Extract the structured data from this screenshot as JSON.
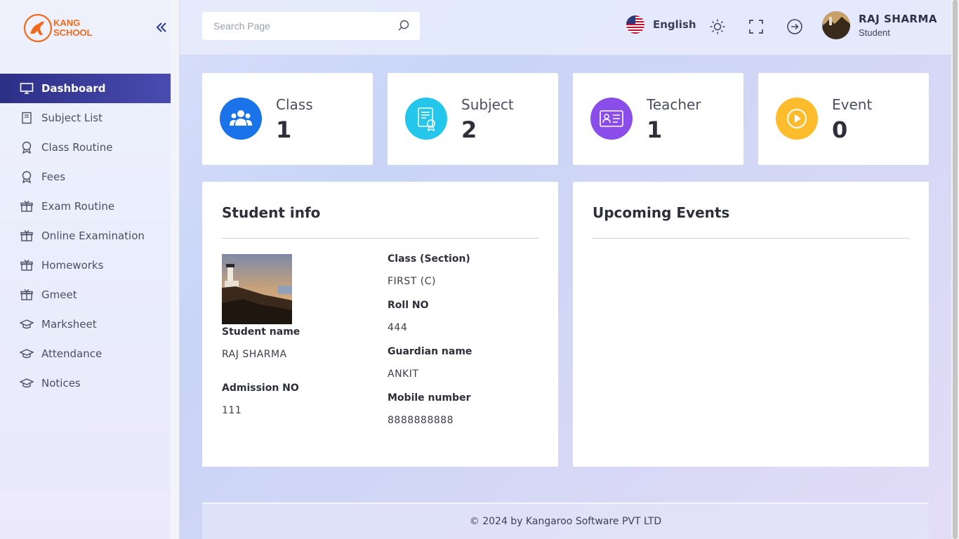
{
  "brand": {
    "line1": "KANG",
    "line2": "SCHOOL",
    "accent": "#f26b1d"
  },
  "sidebar": {
    "items": [
      {
        "label": "Dashboard",
        "icon": "monitor-icon",
        "active": true
      },
      {
        "label": "Subject List",
        "icon": "book-icon"
      },
      {
        "label": "Class Routine",
        "icon": "award-icon"
      },
      {
        "label": "Fees",
        "icon": "award-icon"
      },
      {
        "label": "Exam Routine",
        "icon": "gift-icon"
      },
      {
        "label": "Online Examination",
        "icon": "gift-icon"
      },
      {
        "label": "Homeworks",
        "icon": "gift-icon"
      },
      {
        "label": "Gmeet",
        "icon": "gift-icon"
      },
      {
        "label": "Marksheet",
        "icon": "graduation-cap-icon"
      },
      {
        "label": "Attendance",
        "icon": "graduation-cap-icon"
      },
      {
        "label": "Notices",
        "icon": "graduation-cap-icon"
      }
    ]
  },
  "header": {
    "search_placeholder": "Search Page",
    "language": "English",
    "user_name": "RAJ SHARMA",
    "user_role": "Student"
  },
  "stats": [
    {
      "label": "Class",
      "value": "1",
      "color": "#1a73e8",
      "icon": "users-icon"
    },
    {
      "label": "Subject",
      "value": "2",
      "color": "#25c6ec",
      "icon": "certificate-icon"
    },
    {
      "label": "Teacher",
      "value": "1",
      "color": "#8a4dea",
      "icon": "id-card-icon"
    },
    {
      "label": "Event",
      "value": "0",
      "color": "#fcbc2c",
      "icon": "play-icon"
    }
  ],
  "student_info": {
    "title": "Student info",
    "student_name_label": "Student name",
    "student_name": "RAJ SHARMA",
    "admission_label": "Admission NO",
    "admission": "111",
    "class_label": "Class (Section)",
    "class": "FIRST (C)",
    "roll_label": "Roll NO",
    "roll": "444",
    "guardian_label": "Guardian name",
    "guardian": "ANKIT",
    "mobile_label": "Mobile number",
    "mobile": "8888888888"
  },
  "events": {
    "title": "Upcoming Events"
  },
  "footer": {
    "text": "© 2024 by Kangaroo Software PVT LTD"
  }
}
